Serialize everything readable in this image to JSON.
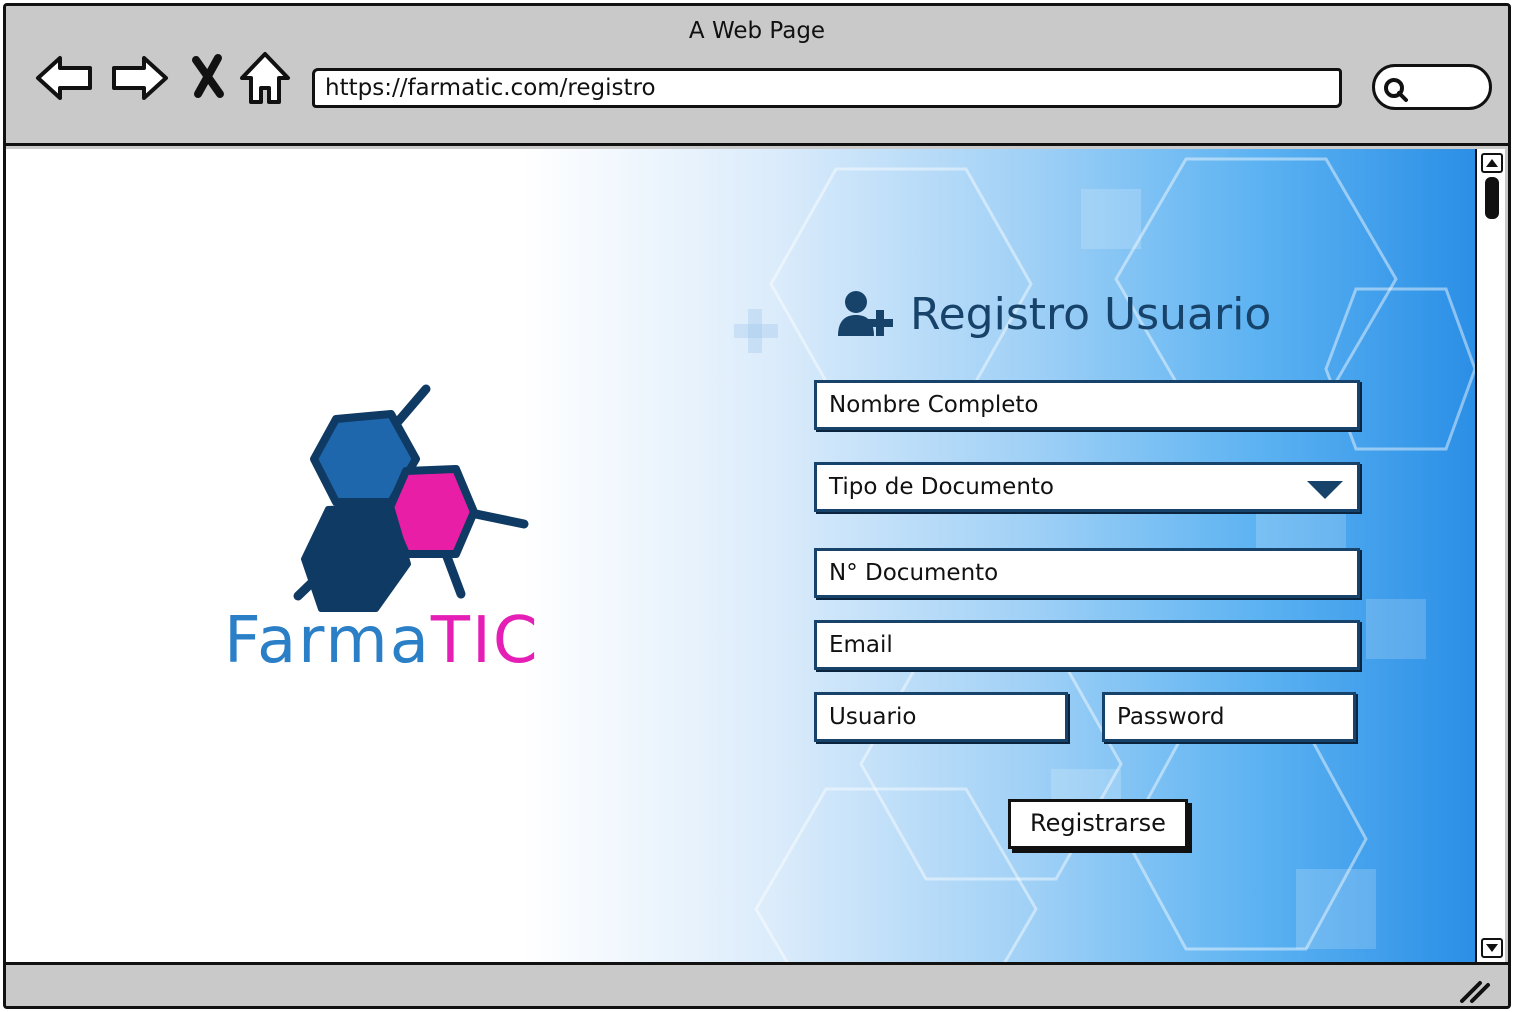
{
  "window": {
    "title": "A Web Page"
  },
  "browser": {
    "url": "https://farmatic.com/registro",
    "nav": {
      "back_icon": "arrow-left-icon",
      "forward_icon": "arrow-right-icon",
      "stop_icon": "close-icon",
      "home_icon": "home-icon"
    },
    "search_icon": "search-icon"
  },
  "logo": {
    "brand_part1": "Farma",
    "brand_part2": "TIC",
    "colors": {
      "light_blue": "#2a7fc6",
      "dark_blue": "#0f3a63",
      "magenta": "#e51fb5"
    }
  },
  "form": {
    "title": "Registro Usuario",
    "title_icon": "user-plus-icon",
    "fields": {
      "full_name": "Nombre Completo",
      "doc_type": "Tipo de Documento",
      "doc_number": "N° Documento",
      "email": "Email",
      "username": "Usuario",
      "password": "Password"
    },
    "submit_label": "Registrarse"
  },
  "colors": {
    "accent": "#17436b",
    "background_end": "#2b8fe6"
  }
}
